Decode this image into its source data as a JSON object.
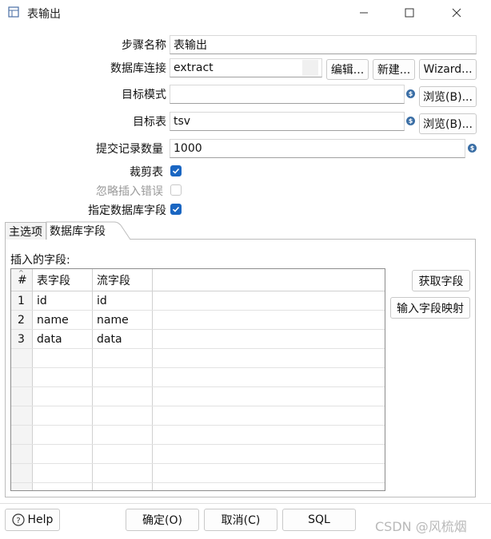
{
  "window": {
    "title": "表输出",
    "minimize_glyph": "—",
    "maximize_glyph": "☐",
    "close_glyph": "✕"
  },
  "form": {
    "step_name_label": "步骤名称",
    "step_name_value": "表输出",
    "db_connection_label": "数据库连接",
    "db_connection_value": "extract",
    "edit_button": "编辑...",
    "new_button": "新建...",
    "wizard_button": "Wizard...",
    "target_schema_label": "目标模式",
    "target_schema_value": "",
    "browse_button_1": "浏览(B)...",
    "target_table_label": "目标表",
    "target_table_value": "tsv",
    "browse_button_2": "浏览(B)...",
    "commit_size_label": "提交记录数量",
    "commit_size_value": "1000",
    "truncate_label": "裁剪表",
    "truncate_checked": true,
    "ignore_errors_label": "忽略插入错误",
    "ignore_errors_checked": false,
    "specify_fields_label": "指定数据库字段",
    "specify_fields_checked": true,
    "variable_icon_glyph": "$"
  },
  "tabs": [
    {
      "label": "主选项",
      "active": false
    },
    {
      "label": "数据库字段",
      "active": true
    }
  ],
  "fields_panel": {
    "caption": "插入的字段:",
    "columns": [
      "#",
      "表字段",
      "流字段"
    ],
    "rows": [
      {
        "num": "1",
        "table_field": "id",
        "stream_field": "id"
      },
      {
        "num": "2",
        "table_field": "name",
        "stream_field": "name"
      },
      {
        "num": "3",
        "table_field": "data",
        "stream_field": "data"
      }
    ],
    "get_fields_button": "获取字段",
    "mapping_button": "输入字段映射"
  },
  "footer": {
    "help_button": "Help",
    "ok_button": "确定(O)",
    "cancel_button": "取消(C)",
    "sql_button": "SQL",
    "watermark": "CSDN @风梳烟"
  },
  "colors": {
    "checkbox_accent": "#1a66c2",
    "variable_icon": "#3a6ea5"
  }
}
